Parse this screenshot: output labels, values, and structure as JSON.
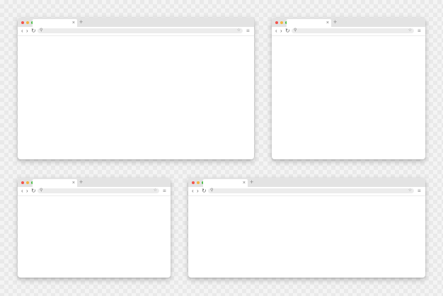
{
  "windows": [
    {
      "id": "w1",
      "close_glyph": "×",
      "newtab_glyph": "+"
    },
    {
      "id": "w2",
      "close_glyph": "×",
      "newtab_glyph": "+"
    },
    {
      "id": "w3",
      "close_glyph": "×",
      "newtab_glyph": "+"
    },
    {
      "id": "w4",
      "close_glyph": "×",
      "newtab_glyph": "+"
    }
  ],
  "icons": {
    "back": "‹",
    "forward": "›",
    "reload": "↻",
    "search": "⚲",
    "star": "☆",
    "menu": "≡"
  },
  "colors": {
    "dot_close": "#f2544d",
    "dot_minimize": "#f3b641",
    "dot_maximize": "#4ebf4a",
    "titlebar": "#e3e3e3",
    "address_bar": "#ececec"
  }
}
